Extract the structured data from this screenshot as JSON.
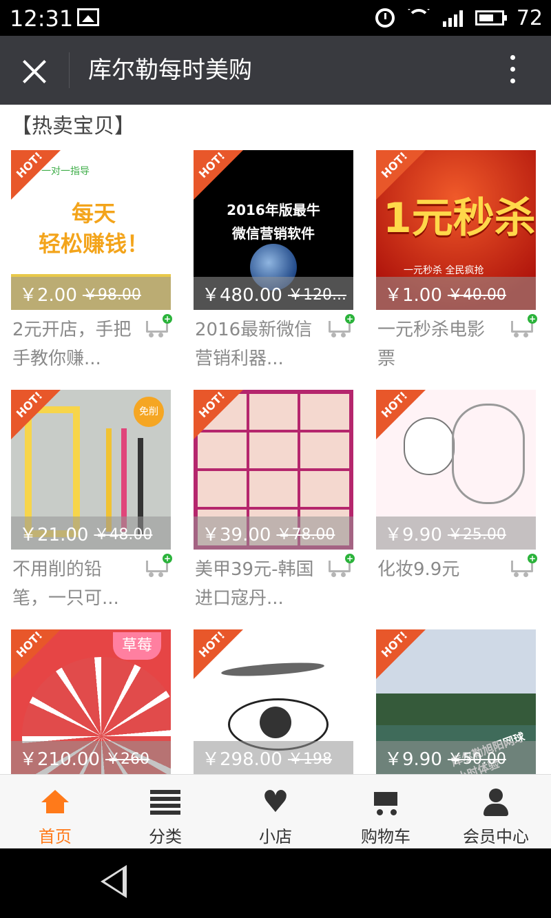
{
  "status": {
    "time": "12:31",
    "battery": "72"
  },
  "nav": {
    "title": "库尔勒每时美购"
  },
  "section": {
    "title": "【热卖宝贝】"
  },
  "hot_label": "HOT!",
  "products": [
    {
      "thumb_text": "每天\n轻松赚钱！",
      "thumb_header": "一对一指导",
      "price": "￥2.00",
      "orig": "￥98.00",
      "name": "2元开店，手把手教你赚..."
    },
    {
      "thumb_text": "2016年版最牛\n微信营销软件",
      "price": "￥480.00",
      "orig": "￥120...",
      "name": "2016最新微信营销利器..."
    },
    {
      "thumb_text": "1元秒杀",
      "thumb_sub": "一元秒杀 全民疯抢",
      "price": "￥1.00",
      "orig": "￥40.00",
      "name": "一元秒杀电影票"
    },
    {
      "thumb_badge": "免削",
      "price": "￥21.00",
      "orig": "￥48.00",
      "name": "不用削的铅笔，一只可..."
    },
    {
      "price": "￥39.00",
      "orig": "￥78.00",
      "name": "美甲39元-韩国进口寇丹..."
    },
    {
      "price": "￥9.90",
      "orig": "￥25.00",
      "name": "化妆9.9元"
    },
    {
      "thumb_tag": "草莓",
      "price": "￥210.00",
      "orig": "￥260",
      "name": ""
    },
    {
      "price": "￥298.00",
      "orig": "￥198",
      "name": ""
    },
    {
      "thumb_text": "库尔勒旭阳网球\n小时体验",
      "price": "￥9.90",
      "orig": "￥50.00",
      "name": ""
    }
  ],
  "tabs": [
    {
      "label": "首页",
      "icon": "home-icon"
    },
    {
      "label": "分类",
      "icon": "list-icon"
    },
    {
      "label": "小店",
      "icon": "heart-icon"
    },
    {
      "label": "购物车",
      "icon": "cart-icon"
    },
    {
      "label": "会员中心",
      "icon": "user-icon"
    }
  ],
  "colors": {
    "accent": "#ff7a1a",
    "hot": "#e8572a",
    "nav": "#393a3f",
    "cart_plus": "#2bb33b"
  }
}
